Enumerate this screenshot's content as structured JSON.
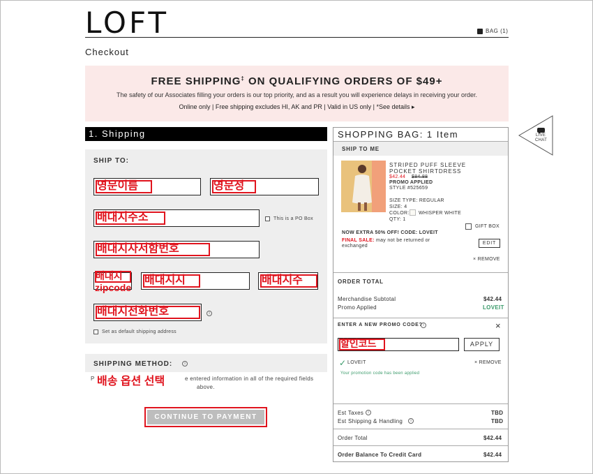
{
  "header": {
    "logo": "LOFT",
    "bag_label": "BAG (1)",
    "page_title": "Checkout"
  },
  "banner": {
    "headline": "FREE SHIPPING",
    "headline_mark": "‡",
    "headline_rest": " ON QUALIFYING ORDERS OF $49+",
    "notice": "The safety of our Associates filling your orders is our top priority, and as a result you will experience delays in receiving your order.",
    "details": "Online only | Free shipping excludes HI, AK and PR | Valid in US only | *See details ▸"
  },
  "shipping": {
    "section_title": "1. Shipping",
    "ship_to_label": "SHIP TO:",
    "first_name_annotation": "영문이름",
    "last_name_annotation": "영문성",
    "address_annotation": "배대지주소",
    "po_box_label": "This is a PO Box",
    "suite_annotation": "배대지사서함번호",
    "zip_annotation": "배대지\nzipcode",
    "city_annotation": "배대지시",
    "state_annotation": "배대지주",
    "phone_annotation": "배대지전화번호",
    "default_label": "Set as default shipping address",
    "method_label": "SHIPPING METHOD:",
    "method_note_a": "P",
    "method_note_b": "e entered information in all of the required fields",
    "method_note_c": "above.",
    "method_annotation": "배송 옵션 선택",
    "continue_label": "CONTINUE TO PAYMENT"
  },
  "bag": {
    "title": "SHOPPING BAG: 1 Item",
    "ship_to_me": "SHIP TO ME",
    "product_name_1": "STRIPED PUFF SLEEVE",
    "product_name_2": "POCKET SHIRTDRESS",
    "price_sale": "$42.44",
    "price_orig": "$84.88",
    "promo_applied": "PROMO APPLIED",
    "style": "STYLE #525659",
    "size_type": "SIZE TYPE: REGULAR",
    "size": "SIZE: 4",
    "color_label": "COLOR:",
    "color_value": "WHISPER WHITE",
    "qty": "QTY: 1",
    "gift_box": "GIFT BOX",
    "extra_off": "NOW EXTRA 50% OFF! CODE: LOVEIT",
    "final_sale_label": "FINAL SALE:",
    "final_sale_text": " may not be returned or",
    "final_sale_text2": "exchanged",
    "edit_label": "EDIT",
    "remove_label": "REMOVE",
    "order_total_label": "ORDER TOTAL",
    "merch_subtotal_label": "Merchandise Subtotal",
    "merch_subtotal_value": "$42.44",
    "promo_applied_label": "Promo Applied",
    "promo_applied_value": "LOVEIT",
    "promo_prompt": "ENTER A NEW PROMO CODE?",
    "promo_annotation": "할인코드",
    "apply_label": "APPLY",
    "promo_code": "LOVEIT",
    "promo_remove": "REMOVE",
    "promo_success": "Your promotion code has been applied",
    "est_taxes_label": "Est Taxes",
    "est_taxes_value": "TBD",
    "est_ship_label": "Est Shipping & Handling",
    "est_ship_value": "TBD",
    "order_total_row_label": "Order Total",
    "order_total_row_value": "$42.44",
    "balance_label": "Order Balance To Credit Card",
    "balance_value": "$42.44"
  },
  "live_chat": {
    "line1": "LIVE",
    "line2": "CHAT"
  },
  "colors": {
    "annotation_red": "#e0141e",
    "banner_pink": "#fbe9e8",
    "promo_green": "#3a9a6a"
  }
}
